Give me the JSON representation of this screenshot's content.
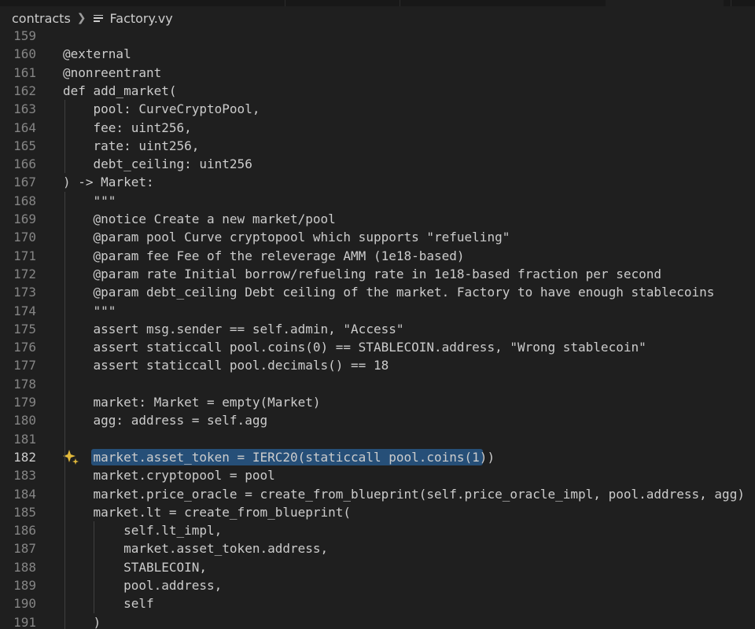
{
  "breadcrumb": {
    "folder": "contracts",
    "file": "Factory.vy",
    "chevron_icon": "chevron-right-icon",
    "file_icon": "file-lines-icon"
  },
  "editor": {
    "active_line": "182",
    "selected_text": "market.asset_token = IERC20(staticcall pool.coins(1))",
    "gutter_icon": "sparkle-icon",
    "lines": [
      {
        "n": "159",
        "text": ""
      },
      {
        "n": "160",
        "text": "@external"
      },
      {
        "n": "161",
        "text": "@nonreentrant"
      },
      {
        "n": "162",
        "text": "def add_market("
      },
      {
        "n": "163",
        "text": "    pool: CurveCryptoPool,"
      },
      {
        "n": "164",
        "text": "    fee: uint256,"
      },
      {
        "n": "165",
        "text": "    rate: uint256,"
      },
      {
        "n": "166",
        "text": "    debt_ceiling: uint256"
      },
      {
        "n": "167",
        "text": ") -> Market:"
      },
      {
        "n": "168",
        "text": "    \"\"\""
      },
      {
        "n": "169",
        "text": "    @notice Create a new market/pool"
      },
      {
        "n": "170",
        "text": "    @param pool Curve cryptopool which supports \"refueling\""
      },
      {
        "n": "171",
        "text": "    @param fee Fee of the releverage AMM (1e18-based)"
      },
      {
        "n": "172",
        "text": "    @param rate Initial borrow/refueling rate in 1e18-based fraction per second"
      },
      {
        "n": "173",
        "text": "    @param debt_ceiling Debt ceiling of the market. Factory to have enough stablecoins"
      },
      {
        "n": "174",
        "text": "    \"\"\""
      },
      {
        "n": "175",
        "text": "    assert msg.sender == self.admin, \"Access\""
      },
      {
        "n": "176",
        "text": "    assert staticcall pool.coins(0) == STABLECOIN.address, \"Wrong stablecoin\""
      },
      {
        "n": "177",
        "text": "    assert staticcall pool.decimals() == 18"
      },
      {
        "n": "178",
        "text": ""
      },
      {
        "n": "179",
        "text": "    market: Market = empty(Market)"
      },
      {
        "n": "180",
        "text": "    agg: address = self.agg"
      },
      {
        "n": "181",
        "text": ""
      },
      {
        "n": "182",
        "text": "    market.asset_token = IERC20(staticcall pool.coins(1))"
      },
      {
        "n": "183",
        "text": "    market.cryptopool = pool"
      },
      {
        "n": "184",
        "text": "    market.price_oracle = create_from_blueprint(self.price_oracle_impl, pool.address, agg)"
      },
      {
        "n": "185",
        "text": "    market.lt = create_from_blueprint("
      },
      {
        "n": "186",
        "text": "        self.lt_impl,"
      },
      {
        "n": "187",
        "text": "        market.asset_token.address,"
      },
      {
        "n": "188",
        "text": "        STABLECOIN,"
      },
      {
        "n": "189",
        "text": "        pool.address,"
      },
      {
        "n": "190",
        "text": "        self"
      },
      {
        "n": "191",
        "text": "    )"
      }
    ]
  }
}
